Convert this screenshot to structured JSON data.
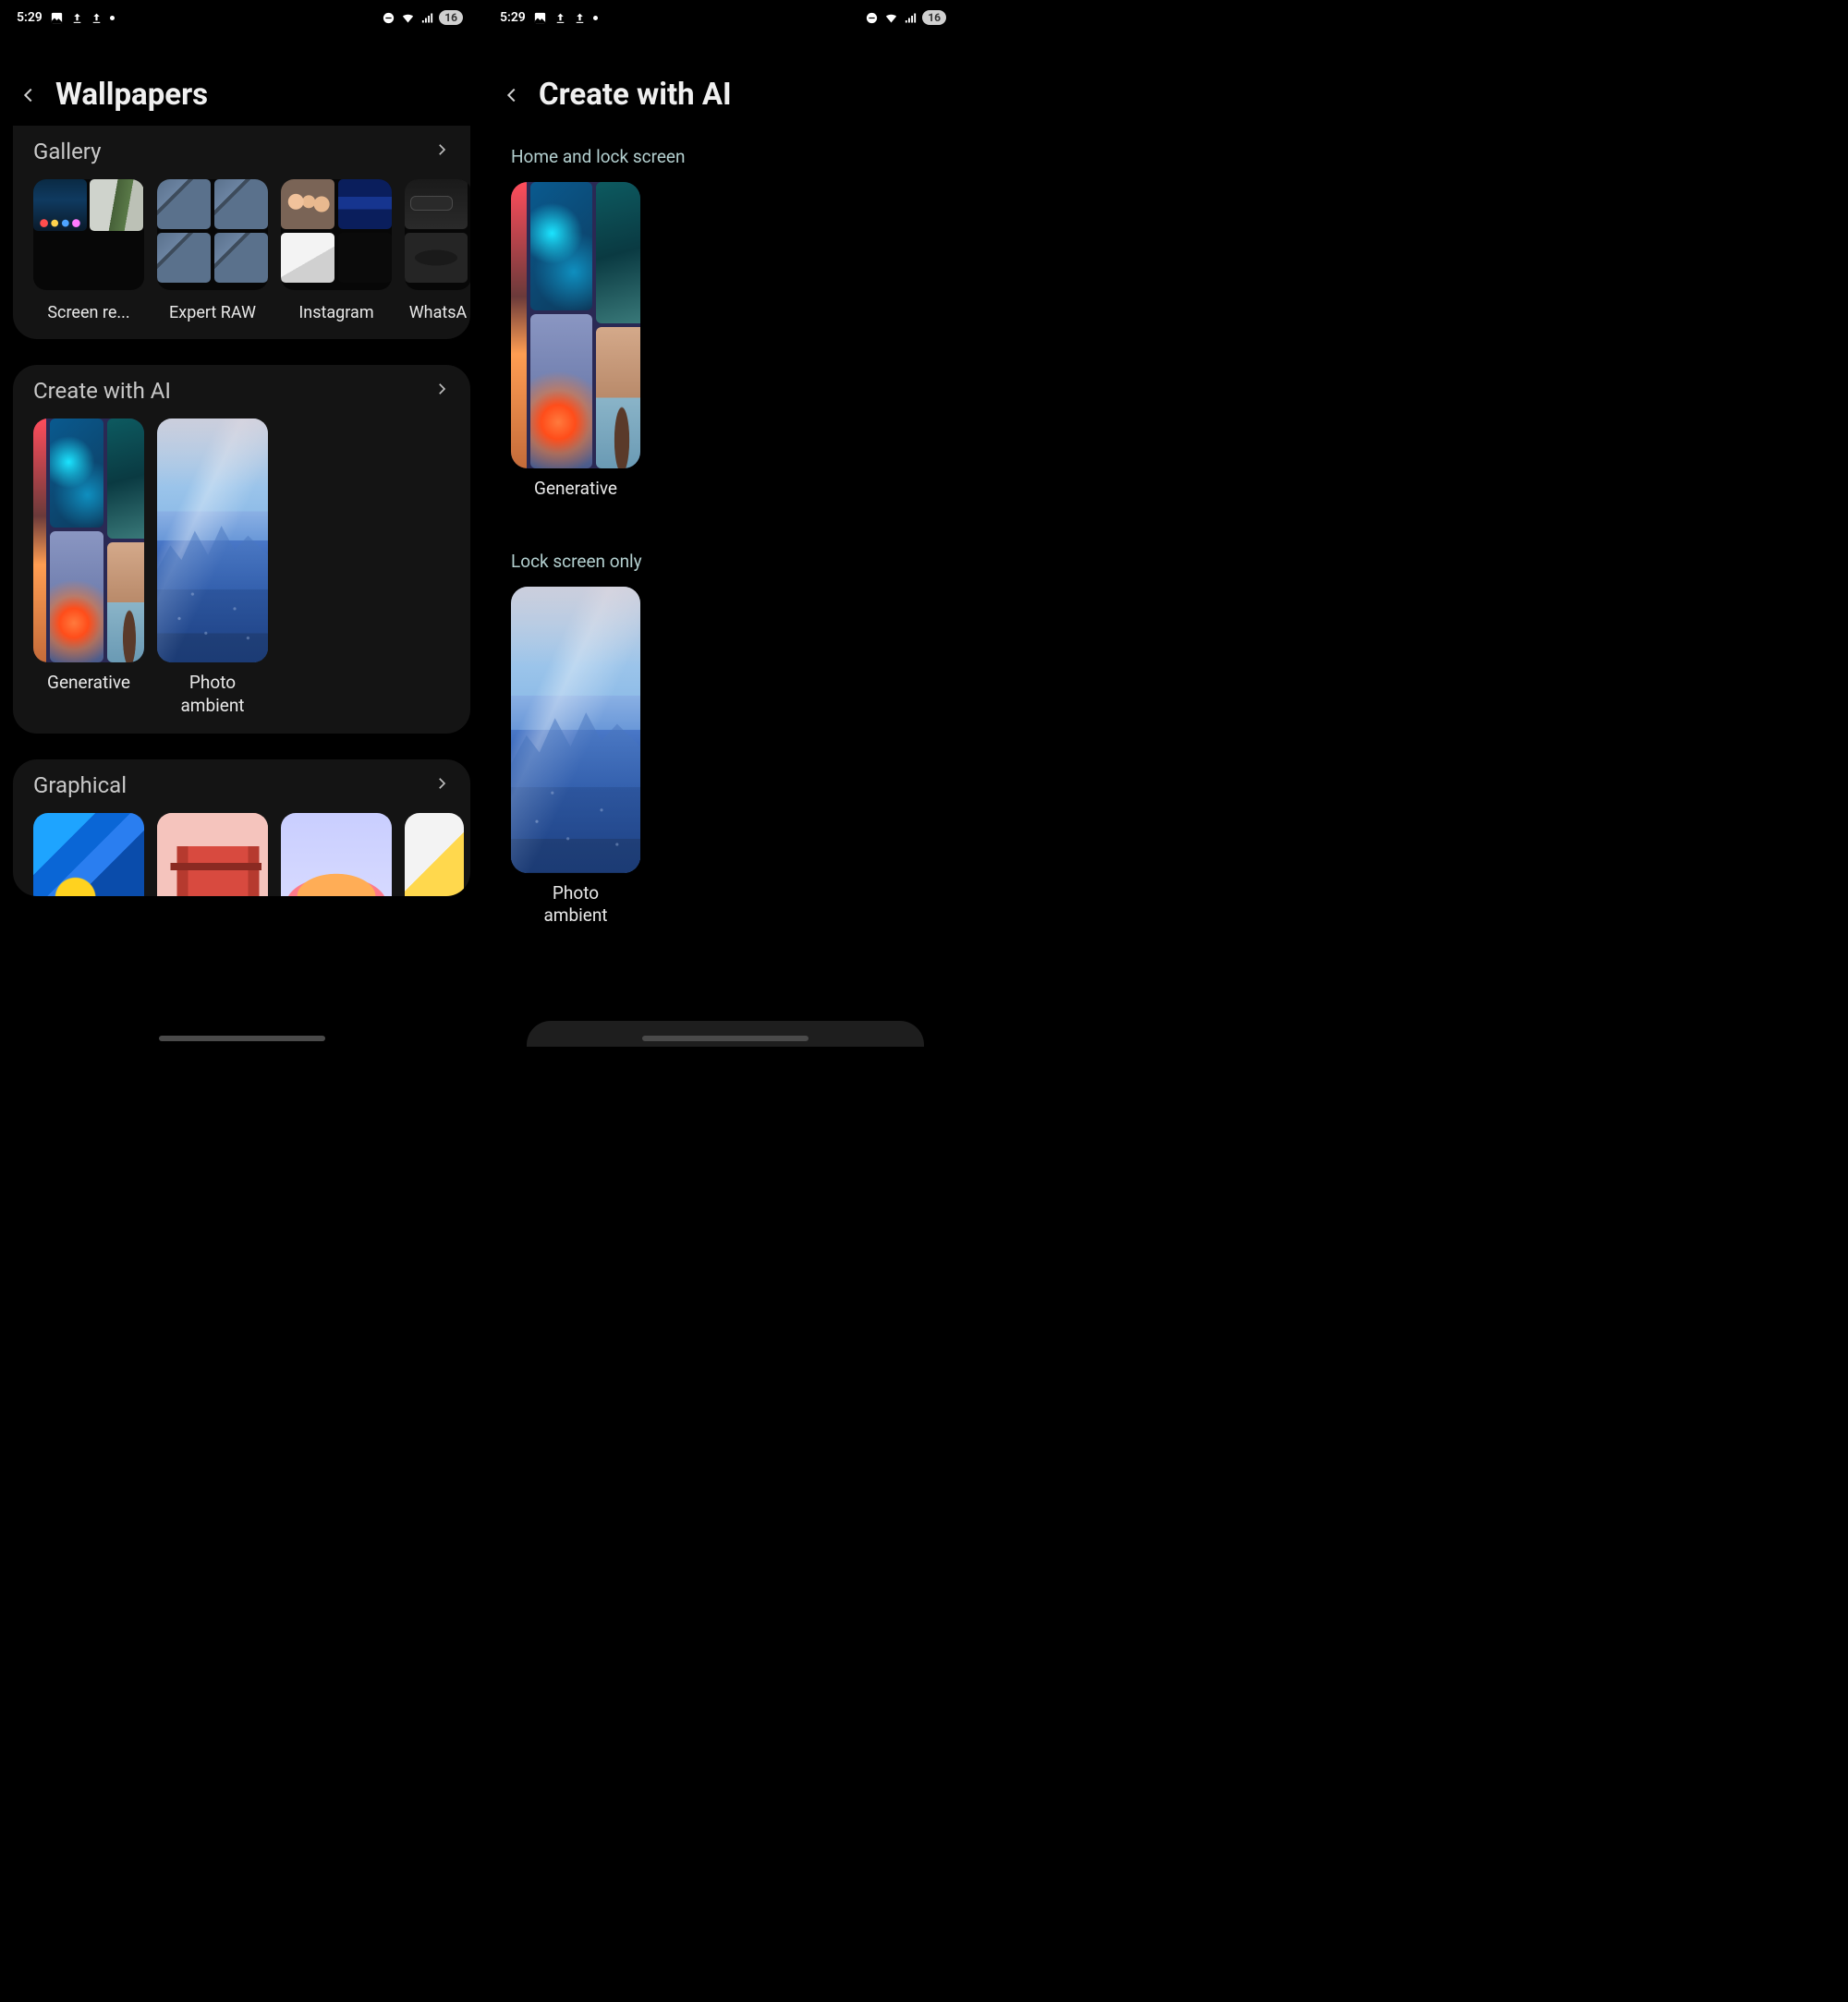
{
  "status": {
    "time": "5:29",
    "battery": "16"
  },
  "left": {
    "title": "Wallpapers",
    "sections": {
      "gallery": {
        "title": "Gallery",
        "items": [
          {
            "label": "Screen re..."
          },
          {
            "label": "Expert RAW"
          },
          {
            "label": "Instagram"
          },
          {
            "label": "WhatsA"
          }
        ]
      },
      "ai": {
        "title": "Create with AI",
        "items": [
          {
            "label": "Generative"
          },
          {
            "label": "Photo\nambient"
          }
        ]
      },
      "graphical": {
        "title": "Graphical"
      }
    }
  },
  "right": {
    "title": "Create with AI",
    "sections": {
      "both": {
        "title": "Home and lock screen",
        "items": [
          {
            "label": "Generative"
          }
        ]
      },
      "lock": {
        "title": "Lock screen only",
        "items": [
          {
            "label": "Photo\nambient"
          }
        ]
      }
    }
  }
}
